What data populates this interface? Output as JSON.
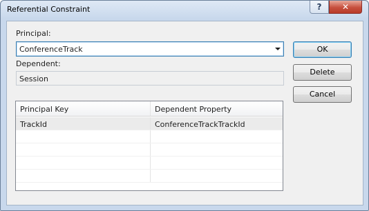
{
  "window": {
    "title": "Referential Constraint",
    "help_glyph": "?",
    "close_glyph": "✕"
  },
  "principal": {
    "label": "Principal:",
    "value": "ConferenceTrack"
  },
  "dependent": {
    "label": "Dependent:",
    "value": "Session"
  },
  "buttons": {
    "ok": "OK",
    "delete": "Delete",
    "cancel": "Cancel"
  },
  "grid": {
    "columns": [
      "Principal Key",
      "Dependent Property"
    ],
    "rows": [
      [
        "TrackId",
        "ConferenceTrackTrackId"
      ],
      [
        "",
        ""
      ],
      [
        "",
        ""
      ],
      [
        "",
        ""
      ],
      [
        "",
        ""
      ]
    ]
  }
}
